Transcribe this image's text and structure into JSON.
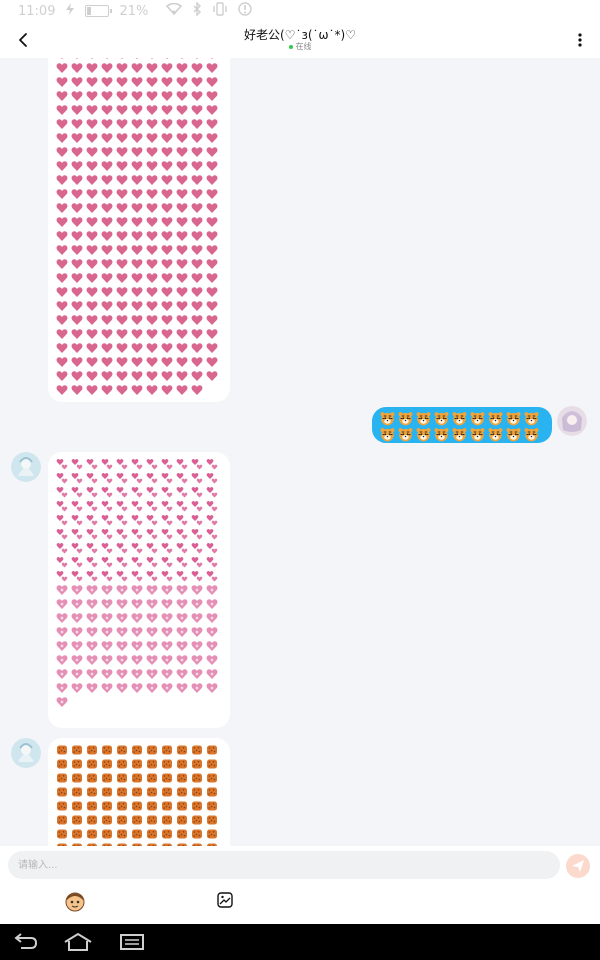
{
  "status_bar": {
    "time": "11:09",
    "battery_text": "21%",
    "battery_level": 0.21,
    "icons": [
      "flash-icon",
      "battery-icon",
      "wifi-icon",
      "bluetooth-icon",
      "vibrate-icon",
      "alert-icon"
    ]
  },
  "header": {
    "title": "好老公(♡˙ɜ(˙ω˙*)♡",
    "status": "在线",
    "status_color": "#37c74a"
  },
  "messages": [
    {
      "side": "received",
      "emoji": "pink-heart",
      "emoji_name": "heart-icon",
      "rows": 26,
      "cols": 11,
      "last_row_count": 10,
      "partial_top": true
    },
    {
      "side": "sent",
      "emoji": "tiger-face",
      "emoji_name": "tiger-icon",
      "rows": 2,
      "cols": 9,
      "last_row_count": 9
    },
    {
      "side": "received",
      "emoji": "two-hearts",
      "emoji_name": "two-hearts-icon",
      "rows": 9,
      "cols": 11,
      "last_row_count": 11
    },
    {
      "side": "received",
      "emoji": "sparkling-heart",
      "emoji_name": "sparkling-heart-icon",
      "rows": 9,
      "cols": 11,
      "last_row_count": 1
    },
    {
      "side": "received",
      "emoji": "brown-cookie",
      "emoji_name": "cookie-icon",
      "rows": 8,
      "cols": 11,
      "last_row_count": 11,
      "partial_bottom": true
    }
  ],
  "input": {
    "placeholder": "请输入..."
  },
  "toolbar": {
    "icons": [
      "emoji-icon",
      "image-icon"
    ]
  },
  "colors": {
    "sent_bubble": "#2ab3f1",
    "received_bubble": "#ffffff",
    "chat_bg": "#f3f5f8",
    "send_button": "#fbd9cd",
    "heart": "#d9668f"
  }
}
